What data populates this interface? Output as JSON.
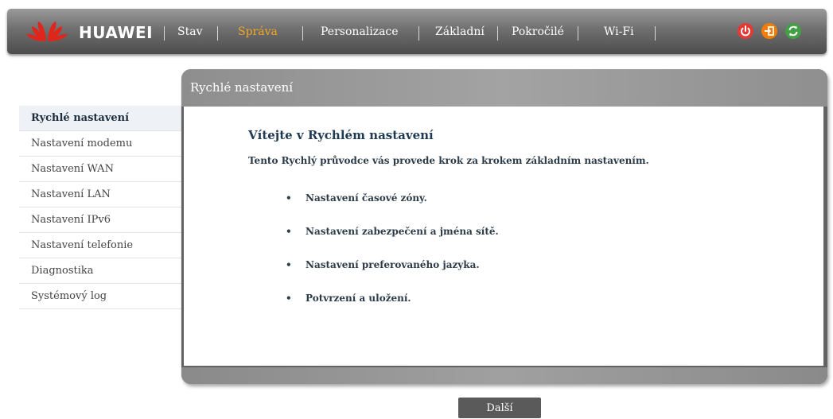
{
  "brand": {
    "name": "HUAWEI",
    "logo_color": "#e1251b"
  },
  "nav": {
    "items": [
      {
        "label": "Stav",
        "active": false
      },
      {
        "label": "Správa",
        "active": true
      },
      {
        "label": "Personalizace",
        "active": false
      },
      {
        "label": "Základní",
        "active": false
      },
      {
        "label": "Pokročilé",
        "active": false
      },
      {
        "label": "Wi-Fi",
        "active": false
      }
    ],
    "active_color": "#f5a623"
  },
  "top_icons": [
    {
      "name": "power-icon",
      "color": "#e53935"
    },
    {
      "name": "logout-icon",
      "color": "#f57c00"
    },
    {
      "name": "refresh-icon",
      "color": "#43a047"
    }
  ],
  "sidebar": {
    "items": [
      {
        "label": "Rychlé nastavení",
        "active": true
      },
      {
        "label": "Nastavení modemu",
        "active": false
      },
      {
        "label": "Nastavení WAN",
        "active": false
      },
      {
        "label": "Nastavení LAN",
        "active": false
      },
      {
        "label": "Nastavení IPv6",
        "active": false
      },
      {
        "label": "Nastavení telefonie",
        "active": false
      },
      {
        "label": "Diagnostika",
        "active": false
      },
      {
        "label": "Systémový log",
        "active": false
      }
    ]
  },
  "panel": {
    "title": "Rychlé nastavení",
    "welcome": "Vítejte v Rychlém nastavení",
    "intro": "Tento Rychlý průvodce vás provede krok za krokem základním nastavením.",
    "steps": [
      "Nastavení časové zóny.",
      "Nastavení zabezpečení a jména sítě.",
      "Nastavení preferovaného jazyka.",
      "Potvrzení a uložení."
    ]
  },
  "actions": {
    "next_label": "Další"
  }
}
